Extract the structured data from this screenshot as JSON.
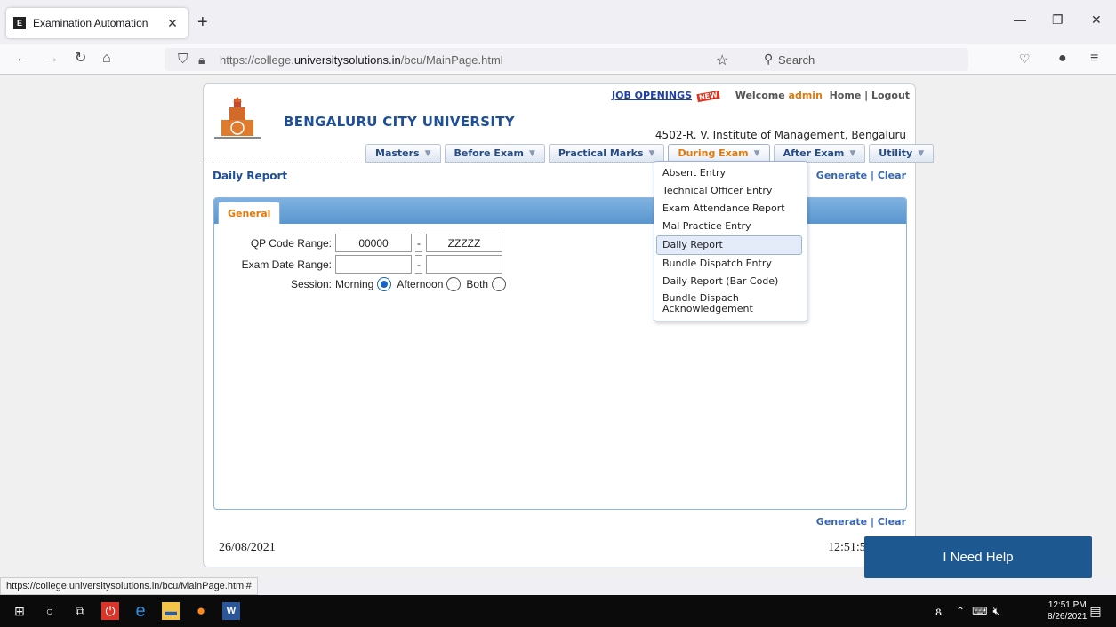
{
  "browser": {
    "tab_title": "Examination Automation",
    "url_prefix": "https://college.",
    "url_domain": "universitysolutions.in",
    "url_path": "/bcu/MainPage.html",
    "search_placeholder": "Search",
    "status_url": "https://college.universitysolutions.in/bcu/MainPage.html#"
  },
  "header": {
    "university_name": "BENGALURU CITY UNIVERSITY",
    "job_openings": "JOB OPENINGS",
    "new_badge": "NEW",
    "welcome": "Welcome",
    "user": "admin",
    "home": "Home",
    "logout": "Logout",
    "college": "4502-R. V. Institute of Management, Bengaluru"
  },
  "menu": [
    {
      "label": "Masters"
    },
    {
      "label": "Before Exam"
    },
    {
      "label": "Practical Marks"
    },
    {
      "label": "During Exam"
    },
    {
      "label": "After Exam"
    },
    {
      "label": "Utility"
    }
  ],
  "dropdown": [
    "Absent Entry",
    "Technical Officer Entry",
    "Exam Attendance Report",
    "Mal Practice Entry",
    "Daily Report",
    "Bundle Dispatch Entry",
    "Daily Report (Bar Code)",
    "Bundle Dispach Acknowledgement"
  ],
  "page": {
    "title": "Daily Report",
    "generate": "Generate",
    "clear": "Clear",
    "tab": "General",
    "qp_label": "QP Code Range:",
    "qp_from": "00000",
    "qp_to": "ZZZZZ",
    "date_label": "Exam Date Range:",
    "date_from": "",
    "date_to": "",
    "session_label": "Session:",
    "session_morning": "Morning",
    "session_afternoon": "Afternoon",
    "session_both": "Both",
    "session_selected": "Morning",
    "footer_date": "26/08/2021",
    "footer_time": "12:51:5"
  },
  "help_button": "I Need Help",
  "taskbar": {
    "time": "12:51 PM",
    "date": "8/26/2021"
  }
}
